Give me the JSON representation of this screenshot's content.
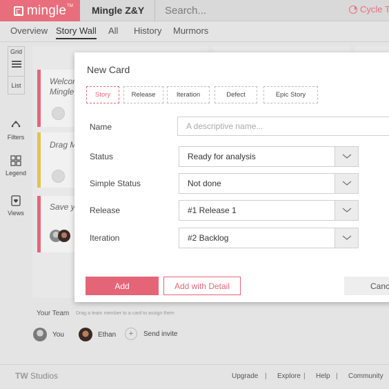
{
  "header": {
    "logo_text": "mingle",
    "logo_tm": "TM",
    "project_name": "Mingle Z&Y",
    "search_placeholder": "Search...",
    "cycle_label": "Cycle Time"
  },
  "nav": {
    "tabs": [
      {
        "label": "Overview"
      },
      {
        "label": "Story Wall"
      },
      {
        "label": "All"
      },
      {
        "label": "History"
      },
      {
        "label": "Murmors"
      }
    ],
    "active_tab": "Story Wall"
  },
  "rail": {
    "grid_label": "Grid",
    "list_label": "List",
    "filters_label": "Filters",
    "legend_label": "Legend",
    "views_label": "Views"
  },
  "board": {
    "cards": [
      {
        "title_line1": "Welcome",
        "title_line2": "Mingle",
        "color": "#e46577"
      },
      {
        "title_line1": "Drag Mo",
        "title_line2": "",
        "color": "#e1c351"
      },
      {
        "title_line1": "Save yo",
        "title_line2": "",
        "color": "#e46577"
      }
    ]
  },
  "team": {
    "label": "Your Team",
    "hint": "Drag a team member to a card to assign them",
    "members": [
      {
        "name": "You"
      },
      {
        "name": "Ethan"
      }
    ],
    "invite_label": "Send invite"
  },
  "footer": {
    "brand_prefix": "TW",
    "brand_suffix": " Studios",
    "links": [
      "Upgrade",
      "Explore",
      "Help",
      "Community"
    ],
    "separator": "|"
  },
  "modal": {
    "title": "New Card",
    "types": [
      "Story",
      "Release",
      "Iteration",
      "Defect",
      "Epic Story"
    ],
    "active_type": "Story",
    "fields": {
      "name_label": "Name",
      "name_placeholder": "A descriptive name...",
      "status_label": "Status",
      "status_value": "Ready for analysis",
      "simple_status_label": "Simple Status",
      "simple_status_value": "Not done",
      "release_label": "Release",
      "release_value": "#1 Release 1",
      "iteration_label": "Iteration",
      "iteration_value": "#2 Backlog"
    },
    "buttons": {
      "add": "Add",
      "add_with_detail": "Add with Detail",
      "cancel": "Cancel"
    }
  },
  "colors": {
    "accent": "#e46577",
    "logo_bg": "#e96e7d",
    "card_yellow": "#e1c351"
  }
}
